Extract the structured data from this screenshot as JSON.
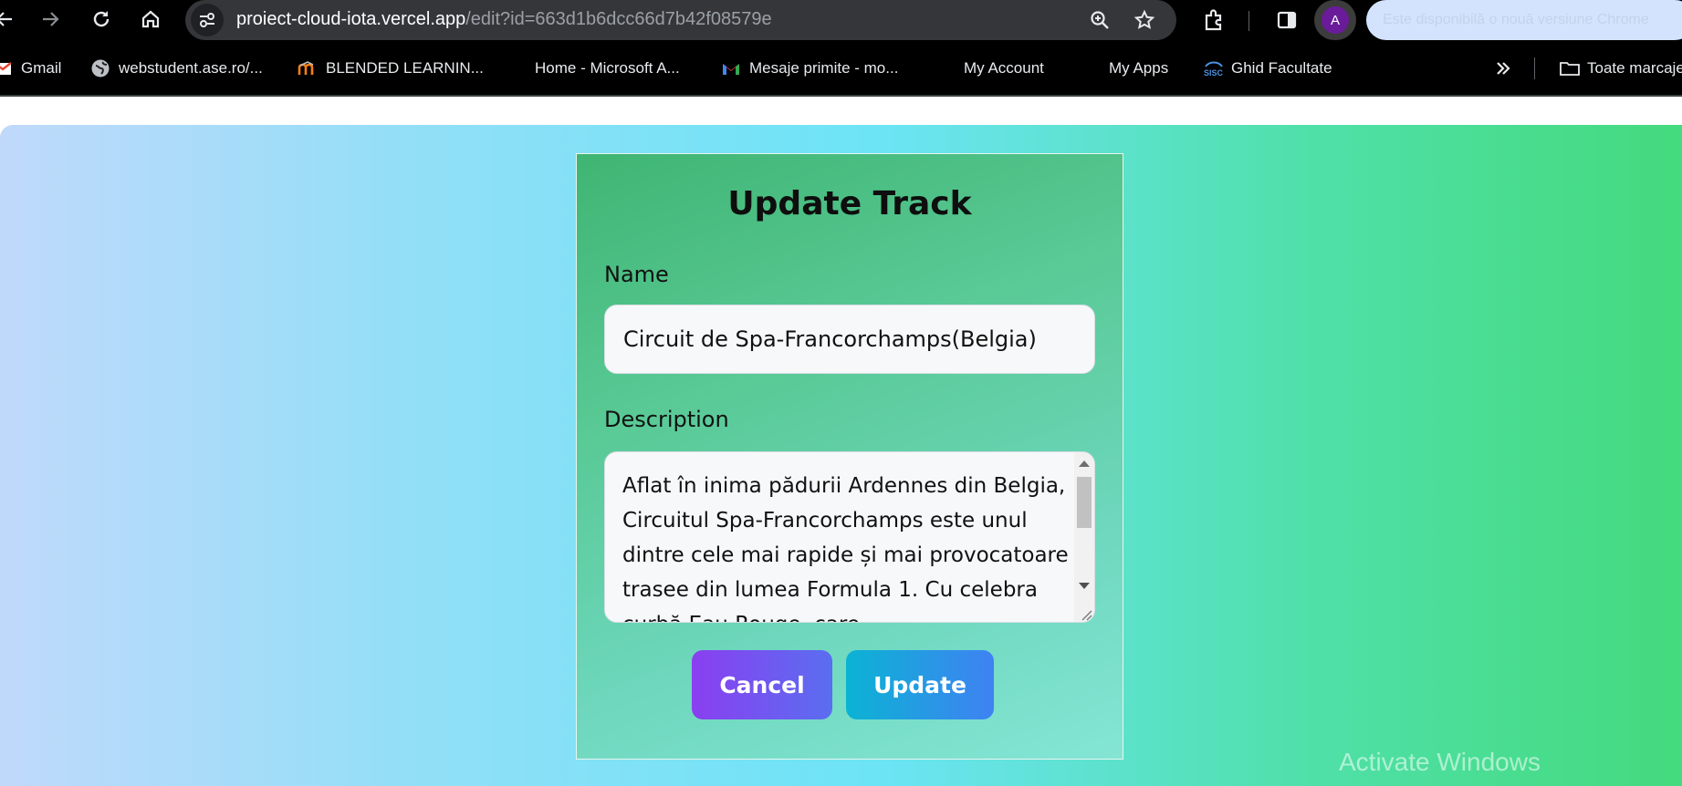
{
  "browser": {
    "url_host": "proiect-cloud-iota.vercel.app",
    "url_path": "/edit?id=663d1b6dcc66d7b42f08579e",
    "profile_initial": "A",
    "update_notice": "Este disponibilă o nouă versiune Chrome",
    "icons": [
      "back-arrow-icon",
      "forward-arrow-icon",
      "reload-icon",
      "home-icon",
      "site-info-icon",
      "zoom-icon",
      "star-icon",
      "extensions-icon",
      "side-panel-icon"
    ]
  },
  "bookmarks": {
    "items": [
      {
        "label": "Gmail",
        "icon": "gmail-icon"
      },
      {
        "label": "webstudent.ase.ro/...",
        "icon": "globe-icon"
      },
      {
        "label": "BLENDED LEARNIN...",
        "icon": "moodle-icon"
      },
      {
        "label": "Home - Microsoft A...",
        "icon": "microsoft-icon"
      },
      {
        "label": "Mesaje primite - mo...",
        "icon": "gmail-icon"
      },
      {
        "label": "My Account",
        "icon": "microsoft-icon"
      },
      {
        "label": "My Apps",
        "icon": "microsoft-icon"
      },
      {
        "label": "Ghid Facultate",
        "icon": "sisc-icon"
      }
    ],
    "overflow_icon": "chevron-double-right-icon",
    "all_bookmarks_label": "Toate marcajele"
  },
  "form": {
    "title": "Update Track",
    "name_label": "Name",
    "name_value": "Circuit de Spa-Francorchamps(Belgia)",
    "description_label": "Description",
    "description_value": "Aflat în inima pădurii Ardennes din Belgia, Circuitul Spa-Francorchamps este unul dintre cele mai rapide și mai provocatoare trasee din lumea Formula 1. Cu celebra curbă Eau Rouge, care",
    "cancel_label": "Cancel",
    "update_label": "Update"
  },
  "overlay": {
    "watermark": "Activate Windows"
  },
  "colors": {
    "chrome_bg": "#000000",
    "omnibox_bg": "#35363a",
    "page_gradient_start": "#c0d9fb",
    "page_gradient_end": "#44da7d",
    "card_gradient_start": "#3fb573",
    "card_gradient_end": "#84e5d5",
    "cancel_gradient_start": "#8a3ff0",
    "cancel_gradient_end": "#5a6ef0",
    "update_gradient_start": "#0bb3d4",
    "update_gradient_end": "#3f82f2"
  }
}
